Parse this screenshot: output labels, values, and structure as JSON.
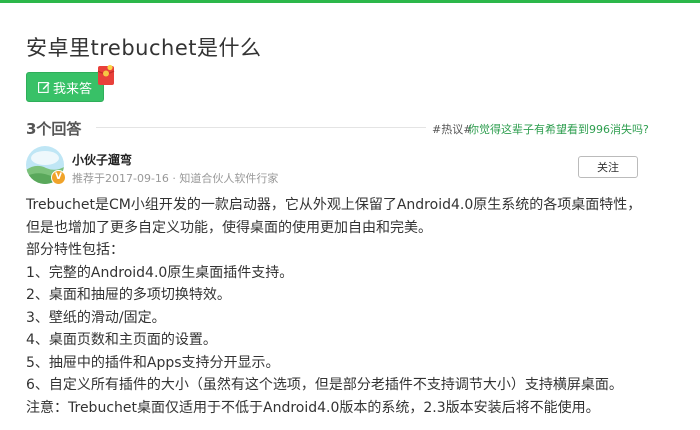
{
  "question": {
    "title": "安卓里trebuchet是什么"
  },
  "answer_button": {
    "label": "我来答",
    "icon": "pen-icon"
  },
  "answers_header": {
    "count_label": "3个回答",
    "hot_tag": "#热议#",
    "hot_link": "你觉得这辈子有希望看到996消失吗?"
  },
  "answer": {
    "author": {
      "name": "小伙子遛弯",
      "meta": "推荐于2017-09-16 · 知道合伙人软件行家",
      "badge": "V"
    },
    "follow_label": "关注",
    "paragraphs": [
      "Trebuchet是CM小组开发的一款启动器，它从外观上保留了Android4.0原生系统的各项桌面特性，",
      "但是也增加了更多自定义功能，使得桌面的使用更加自由和完美。",
      "部分特性包括：",
      "1、完整的Android4.0原生桌面插件支持。",
      "2、桌面和抽屉的多项切换特效。",
      "3、壁纸的滑动/固定。",
      "4、桌面页数和主页面的设置。",
      "5、抽屉中的插件和Apps支持分开显示。",
      "6、自定义所有插件的大小（虽然有这个选项，但是部分老插件不支持调节大小）支持横屏桌面。",
      "注意：Trebuchet桌面仅适用于不低于Android4.0版本的系统，2.3版本安装后将不能使用。"
    ]
  },
  "colors": {
    "brand_green": "#2cb74a",
    "button_green": "#38c167",
    "link_green": "#2e9e4f",
    "badge_orange": "#f0a32a"
  }
}
